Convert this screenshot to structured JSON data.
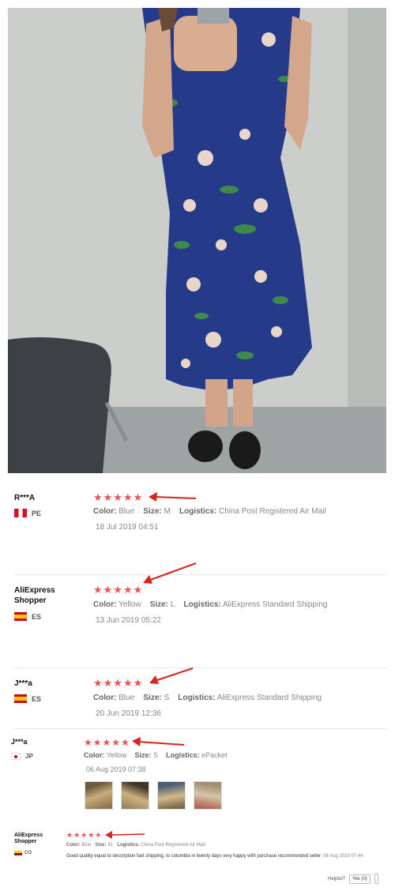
{
  "photo": {
    "icon": "customer-photo"
  },
  "reviews": [
    {
      "user": "R***A",
      "country": "PE",
      "meta": {
        "color_label": "Color:",
        "color": "Blue",
        "size_label": "Size:",
        "size": "M",
        "logistics_label": "Logistics:",
        "logistics": "China Post Registered Air Mail"
      },
      "date": "18 Jul 2019 04:51",
      "rating_stars": "★★★★★",
      "rating": 5
    },
    {
      "user": "AliExpress Shopper",
      "country": "ES",
      "meta": {
        "color_label": "Color:",
        "color": "Yellow",
        "size_label": "Size:",
        "size": "L",
        "logistics_label": "Logistics:",
        "logistics": "AliExpress Standard Shipping"
      },
      "date": "13 Jun 2019 05:22",
      "rating_stars": "★★★★★",
      "rating": 5
    },
    {
      "user": "J***a",
      "country": "ES",
      "meta": {
        "color_label": "Color:",
        "color": "Blue",
        "size_label": "Size:",
        "size": "S",
        "logistics_label": "Logistics:",
        "logistics": "AliExpress Standard Shipping"
      },
      "date": "20 Jun 2019 12:36",
      "rating_stars": "★★★★★",
      "rating": 5
    },
    {
      "user": "J***a",
      "country": "JP",
      "meta": {
        "color_label": "Color:",
        "color": "Yellow",
        "size_label": "Size:",
        "size": "S",
        "logistics_label": "Logistics:",
        "logistics": "ePacket"
      },
      "date": "06 Aug 2019 07:38",
      "rating_stars": "★★★★★",
      "rating": 5
    },
    {
      "user": "AliExpress Shopper",
      "country": "CO",
      "meta": {
        "color_label": "Color:",
        "color": "Blue",
        "size_label": "Size:",
        "size": "XL",
        "logistics_label": "Logistics:",
        "logistics": "China Post Registered Air Mail"
      },
      "text": "Good quality equal to description fast shipping, to colombia in twenty days very happy with purchase recommended seller",
      "date": "08 Aug 2019 07:44",
      "rating_stars": "★★★★★",
      "rating": 5
    }
  ],
  "helpful": {
    "label": "Helpful?",
    "yes": "Yes (0)"
  },
  "colors": {
    "star": "#e8544f",
    "arrow": "#d9231f"
  }
}
